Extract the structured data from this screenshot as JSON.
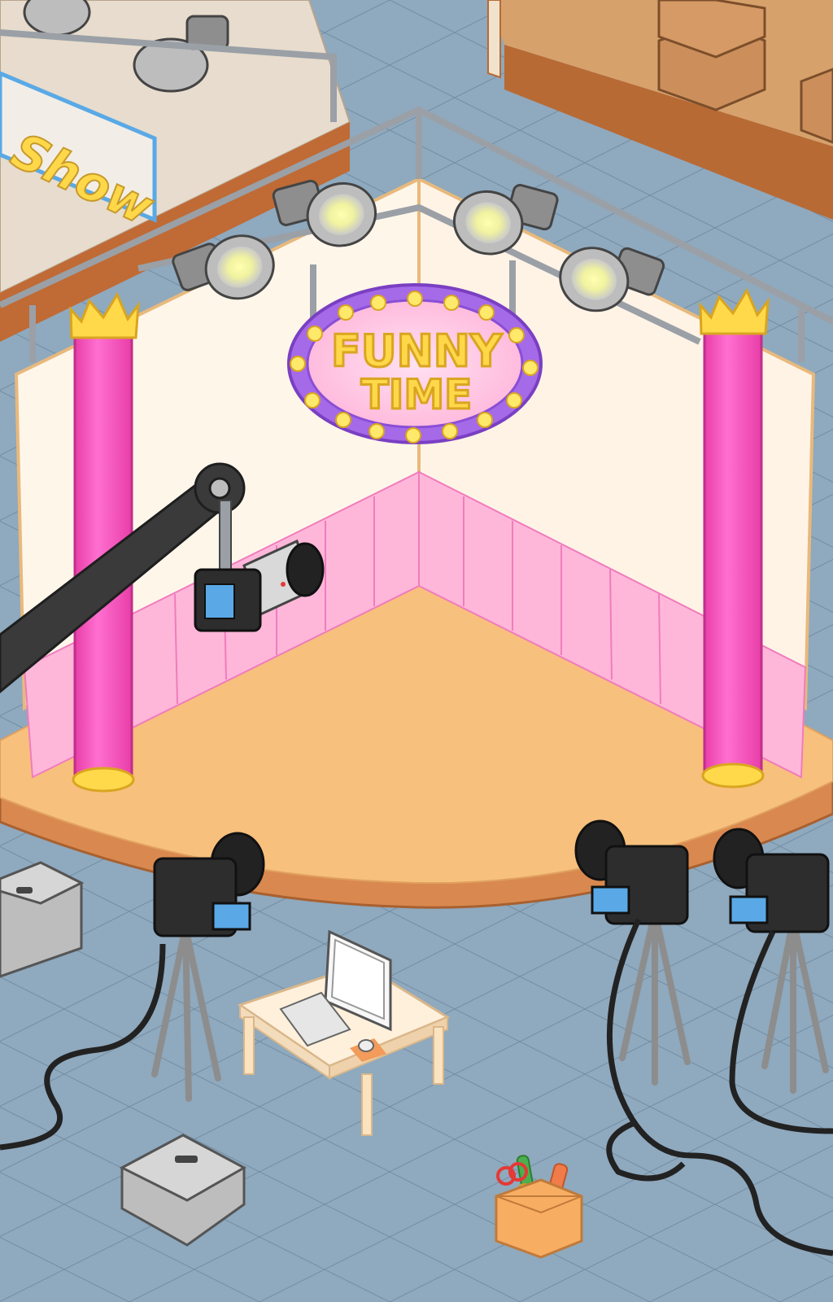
{
  "scene": {
    "title_sign": {
      "line1": "FUNNY",
      "line2": "TIME"
    },
    "neighbor_sign_fragment": "Show",
    "colors": {
      "floor": "#8fa9be",
      "stage_floor": "#f7c07c",
      "stage_edge": "#d9894f",
      "pillar": "#ff5fc6",
      "pillar_cap": "#ffd94a",
      "back_wall": "#fff6ea",
      "wall_panels": "#ffb7d9",
      "sign_ring": "#a56ae8",
      "sign_fill": "#ffc1e1",
      "sign_text": "#ffd84a",
      "camera_body": "#2d2d2d",
      "camera_screen": "#5aa9e6",
      "spotlight": "#c4c4c4",
      "railing": "#9aa0a6"
    },
    "icons": [
      "spotlight-icon",
      "camera-icon",
      "crane-camera-icon",
      "tripod-icon",
      "computer-icon",
      "equipment-case-icon",
      "craft-supplies-box-icon",
      "cardboard-box-icon"
    ]
  }
}
